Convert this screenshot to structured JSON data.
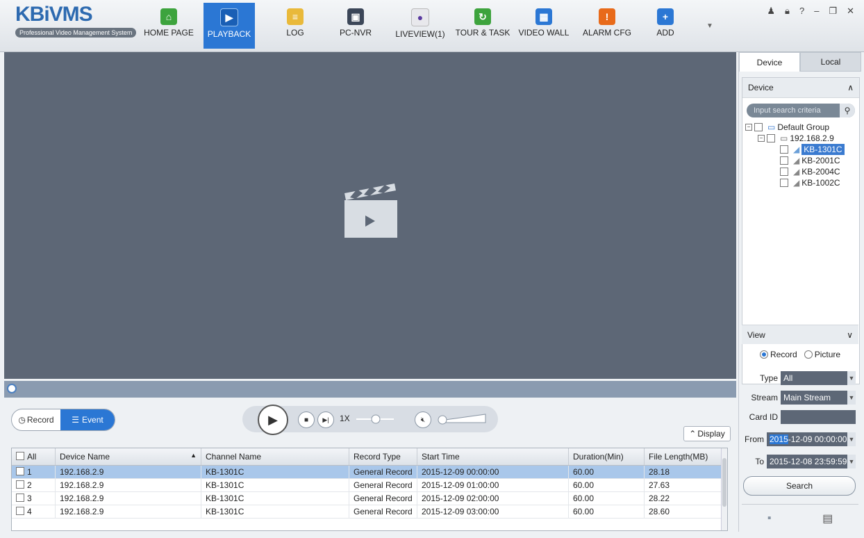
{
  "app": {
    "logo_main": "KBiVMS",
    "logo_sub": "Professional Video Management System"
  },
  "nav": [
    {
      "label": "HOME PAGE",
      "icon": "home-icon",
      "color": "#3da33d"
    },
    {
      "label": "PLAYBACK",
      "icon": "playback-icon",
      "color": "#2b77d4",
      "active": true
    },
    {
      "label": "LOG",
      "icon": "log-icon",
      "color": "#e9b93a"
    },
    {
      "label": "PC-NVR",
      "icon": "pc-nvr-icon",
      "color": "#3b4658"
    },
    {
      "label": "LIVEVIEW(1)",
      "icon": "liveview-icon",
      "color": "#5a5a5a"
    },
    {
      "label": "TOUR & TASK",
      "icon": "tour-task-icon",
      "color": "#3da33d"
    },
    {
      "label": "VIDEO WALL",
      "icon": "video-wall-icon",
      "color": "#2b77d4"
    },
    {
      "label": "ALARM CFG",
      "icon": "alarm-icon",
      "color": "#e86a1a"
    },
    {
      "label": "ADD",
      "icon": "add-icon",
      "color": "#2b77d4"
    }
  ],
  "window_controls": [
    "user-icon",
    "lock-icon",
    "help-icon",
    "minimize-icon",
    "restore-icon",
    "close-icon"
  ],
  "controls": {
    "record_label": "Record",
    "event_label": "Event",
    "speed": "1X",
    "display_label": "Display"
  },
  "table": {
    "headers": [
      "All",
      "Device Name",
      "Channel Name",
      "Record Type",
      "Start Time",
      "Duration(Min)",
      "File Length(MB)"
    ],
    "rows": [
      {
        "no": "1",
        "device": "192.168.2.9",
        "channel": "KB-1301C",
        "type": "General Record",
        "start": "2015-12-09 00:00:00",
        "duration": "60.00",
        "length": "28.18"
      },
      {
        "no": "2",
        "device": "192.168.2.9",
        "channel": "KB-1301C",
        "type": "General Record",
        "start": "2015-12-09 01:00:00",
        "duration": "60.00",
        "length": "27.63"
      },
      {
        "no": "3",
        "device": "192.168.2.9",
        "channel": "KB-1301C",
        "type": "General Record",
        "start": "2015-12-09 02:00:00",
        "duration": "60.00",
        "length": "28.22"
      },
      {
        "no": "4",
        "device": "192.168.2.9",
        "channel": "KB-1301C",
        "type": "General Record",
        "start": "2015-12-09 03:00:00",
        "duration": "60.00",
        "length": "28.60"
      }
    ]
  },
  "sidebar": {
    "tab_device": "Device",
    "tab_local": "Local",
    "panel_title": "Device",
    "search_placeholder": "Input search criteria",
    "group": "Default Group",
    "device_ip": "192.168.2.9",
    "channels": [
      "KB-1301C",
      "KB-2001C",
      "KB-2004C",
      "KB-1002C"
    ],
    "view_title": "View",
    "radio_record": "Record",
    "radio_picture": "Picture",
    "type_label": "Type",
    "type_value": "All",
    "stream_label": "Stream",
    "stream_value": "Main Stream",
    "card_label": "Card ID",
    "card_value": "",
    "from_label": "From",
    "from_year": "2015",
    "from_rest": "-12-09 00:00:00",
    "to_label": "To",
    "to_value": "2015-12-08 23:59:59",
    "search_button": "Search"
  }
}
